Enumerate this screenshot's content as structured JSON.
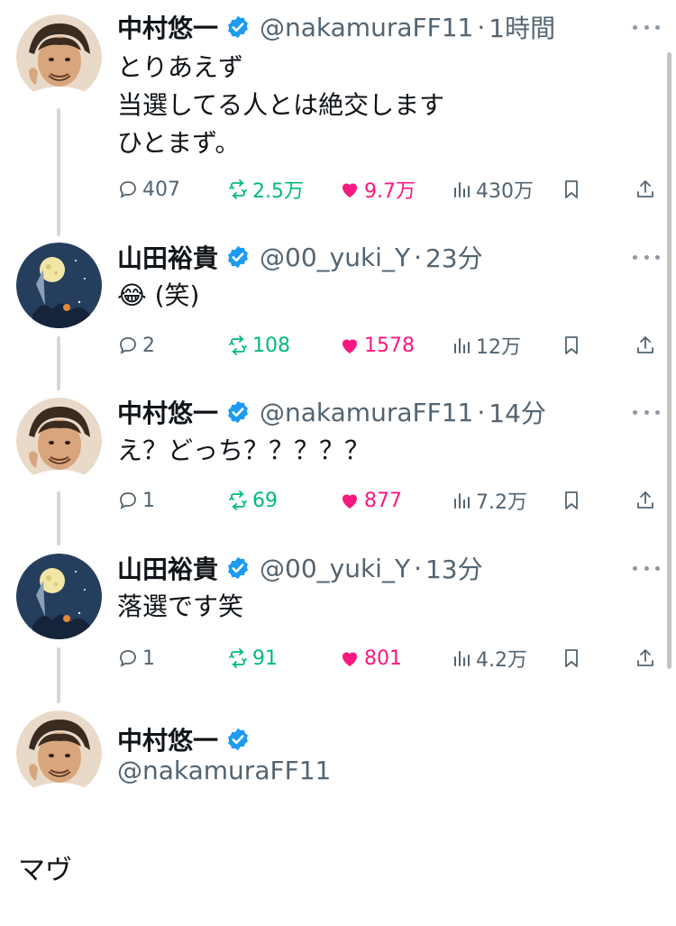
{
  "tweets": [
    {
      "name": "中村悠一",
      "handle": "@nakamuraFF11",
      "sep": "·",
      "time": "1時間",
      "avatar": "avatar-nakamura",
      "text": "とりあえず\n当選してる人とは絶交します\nひとまず。",
      "replies": "407",
      "retweets": "2.5万",
      "likes": "9.7万",
      "views": "430万"
    },
    {
      "name": "山田裕貴",
      "handle": "@00_yuki_Y",
      "sep": "·",
      "time": "23分",
      "avatar": "avatar-yamada",
      "text": "😂 (笑)",
      "replies": "2",
      "retweets": "108",
      "likes": "1578",
      "views": "12万"
    },
    {
      "name": "中村悠一",
      "handle": "@nakamuraFF11",
      "sep": "·",
      "time": "14分",
      "avatar": "avatar-nakamura",
      "text": "え？どっち？？？？？",
      "replies": "1",
      "retweets": "69",
      "likes": "877",
      "views": "7.2万"
    },
    {
      "name": "山田裕貴",
      "handle": "@00_yuki_Y",
      "sep": "·",
      "time": "13分",
      "avatar": "avatar-yamada",
      "text": "落選です笑",
      "replies": "1",
      "retweets": "91",
      "likes": "801",
      "views": "4.2万"
    }
  ],
  "final_tweet": {
    "name": "中村悠一",
    "handle": "@nakamuraFF11"
  },
  "footer_text": "マヴ",
  "colors": {
    "verified": "#1d9bf0",
    "retweet": "#00ba7c",
    "like": "#f91880",
    "muted": "#536471"
  },
  "icons": [
    "reply-icon",
    "retweet-icon",
    "heart-icon",
    "views-icon",
    "bookmark-icon",
    "share-icon",
    "verified-badge-icon",
    "more-icon"
  ]
}
